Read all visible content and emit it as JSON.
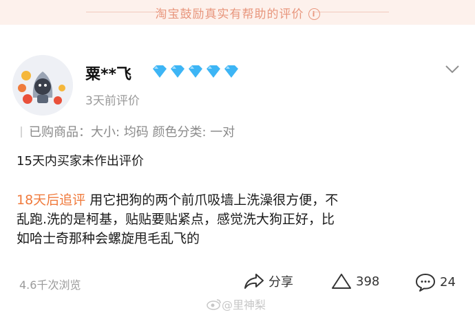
{
  "banner": {
    "text": "淘宝鼓励真实有帮助的评价",
    "info_icon": "info-icon"
  },
  "user": {
    "name": "粟**飞",
    "level_diamonds": 5,
    "time": "3天前评价"
  },
  "sku": {
    "label": "已购商品：大小: 均码  颜色分类: 一对"
  },
  "review": {
    "initial": "15天内买家未作出评价",
    "followup_tag": "18天后追评",
    "followup_line1": "用它把狗的两个前爪吸墙上洗澡很方便，不",
    "followup_line2": "乱跑.洗的是柯基，贴贴要贴紧点，感觉洗大狗正好，比",
    "followup_line3": "如哈士奇那种会螺旋甩毛乱飞的"
  },
  "footer": {
    "views": "4.6千次浏览",
    "share_label": "分享",
    "like_count": "398",
    "comment_count": "24"
  },
  "watermark": {
    "text": "@里神梨"
  },
  "colors": {
    "accent": "#f07a3c",
    "banner_bg": "#fdf1ec",
    "diamond": "#3db5f5"
  }
}
